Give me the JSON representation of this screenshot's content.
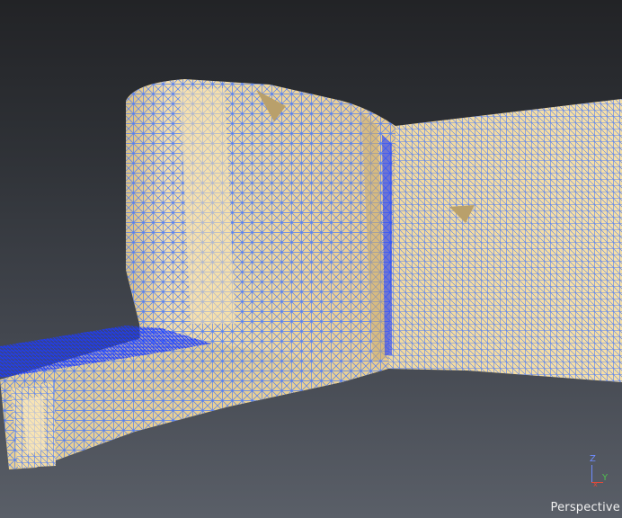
{
  "viewport": {
    "view_name": "Perspective",
    "axes": {
      "z": "Z",
      "y": "Y",
      "x": "x"
    },
    "colors": {
      "background_top": "#222326",
      "background_bottom": "#5a5f68",
      "mesh_fill": "#f3dc9f",
      "mesh_fill_shadow": "#e7c987",
      "wireframe": "#4f7df5",
      "wireframe_dense": "#1e3cff",
      "axis_z": "#6f8cff",
      "axis_y": "#4fc24f",
      "axis_x": "#e04a3a"
    },
    "icons": [
      "axis-gizmo-icon"
    ]
  }
}
